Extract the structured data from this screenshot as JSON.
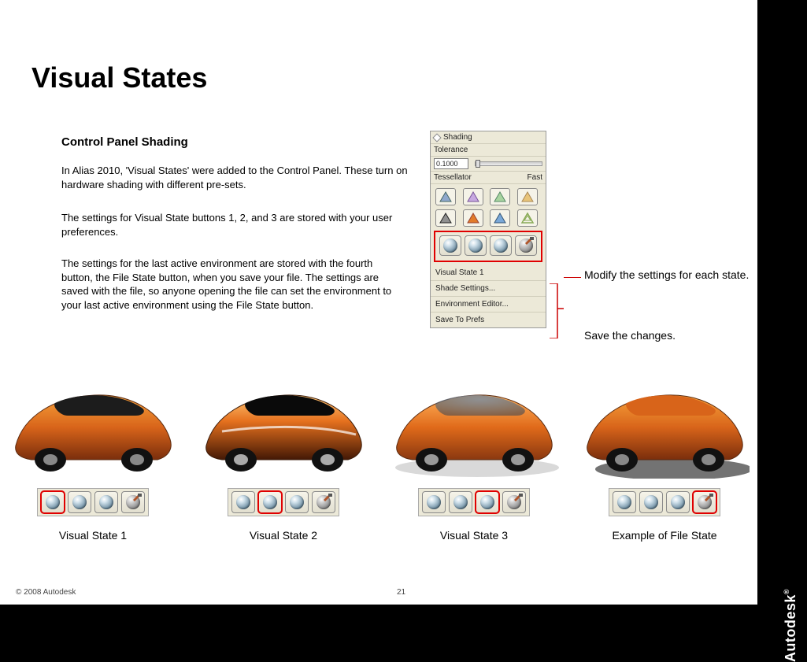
{
  "title": "Visual States",
  "subhead": "Control Panel Shading",
  "para1": "In Alias 2010, 'Visual States' were added to the Control Panel. These turn on hardware shading with different pre-sets.",
  "para2": "The settings for Visual State buttons 1, 2, and 3 are stored with your user preferences.",
  "para3": "The settings for the last active environment are stored with the fourth button, the File State button, when you save your file. The settings are saved with the file, so anyone opening the file can set the environment to your last active environment using the File State button.",
  "panel": {
    "section": "Shading",
    "tolerance_label": "Tolerance",
    "tolerance_value": "0.1000",
    "tess_label": "Tessellator",
    "tess_value": "Fast",
    "vs_label": "Visual State 1",
    "link1": "Shade Settings...",
    "link2": "Environment Editor...",
    "link3": "Save To Prefs"
  },
  "note_modify": "Modify the settings for each state.",
  "note_save": "Save the changes.",
  "cars": [
    {
      "label": "Visual State 1",
      "highlight": 0
    },
    {
      "label": "Visual State 2",
      "highlight": 1
    },
    {
      "label": "Visual State 3",
      "highlight": 2
    },
    {
      "label": "Example of File State",
      "highlight": 3
    }
  ],
  "footer": {
    "copyright": "© 2008 Autodesk",
    "page": "21"
  },
  "brand": "Autodesk"
}
